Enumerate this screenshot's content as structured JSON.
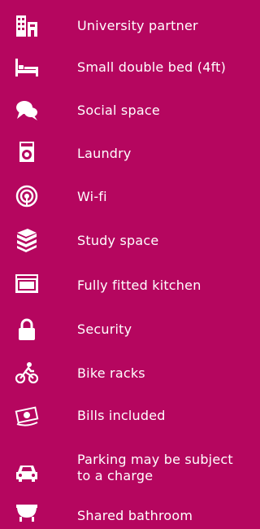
{
  "amenities": [
    {
      "label": "University partner",
      "icon": "building-icon"
    },
    {
      "label": "Small double bed (4ft)",
      "icon": "bed-icon"
    },
    {
      "label": "Social space",
      "icon": "chat-bubbles-icon"
    },
    {
      "label": "Laundry",
      "icon": "washing-machine-icon"
    },
    {
      "label": "Wi-fi",
      "icon": "wifi-icon"
    },
    {
      "label": "Study space",
      "icon": "books-icon"
    },
    {
      "label": "Fully fitted kitchen",
      "icon": "oven-icon"
    },
    {
      "label": "Security",
      "icon": "padlock-icon"
    },
    {
      "label": "Bike racks",
      "icon": "cyclist-icon"
    },
    {
      "label": "Bills included",
      "icon": "banknote-icon"
    },
    {
      "label": "Parking may be subject to a charge",
      "icon": "car-icon"
    },
    {
      "label": "Shared bathroom",
      "icon": "bathtub-icon"
    }
  ],
  "colors": {
    "background": "#b5065f",
    "foreground": "#ffffff"
  }
}
